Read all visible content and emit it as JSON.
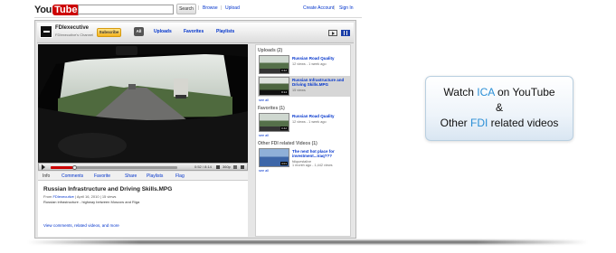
{
  "youtube": {
    "logo_you": "You",
    "logo_tube": "Tube",
    "search_button": "Search",
    "nav": [
      "Browse",
      "Upload"
    ],
    "account": [
      "Create Account",
      "Sign In"
    ]
  },
  "channel": {
    "name": "FDIexecutive",
    "subtitle": "FDIexecutive's Channel",
    "subscribe": "Subscribe",
    "all_button": "All",
    "tabs": [
      "Uploads",
      "Favorites",
      "Playlists"
    ]
  },
  "player": {
    "time": "0:52 / 8:14",
    "quality": "360p",
    "progress": 0.19
  },
  "video_tabs": [
    "Info",
    "Comments",
    "Favorite",
    "Share",
    "Playlists",
    "Flag"
  ],
  "video": {
    "title": "Russian Infrastructure and Driving Skills.MPG",
    "from_label": "From",
    "from_user": "FDIexecutive",
    "meta_rest": "| April 16, 2010 | 15 views",
    "description": "Russian infrastructure - highway between Moscow and Riga",
    "more_link": "View comments, related videos, and more"
  },
  "sidebar": {
    "uploads_header": "Uploads (2)",
    "uploads": [
      {
        "title": "Russian Road Quality",
        "meta": "12 views - 1 week ago",
        "duration": "0:42"
      },
      {
        "title": "Russian Infrastructure and Driving Skills.MPG",
        "meta": "15 views",
        "duration": "8:14"
      }
    ],
    "favorites_header": "Favorites (1)",
    "favorites": [
      {
        "title": "Russian Road Quality",
        "meta": "12 views - 1 week ago",
        "duration": "0:42"
      }
    ],
    "related_header": "Other FDI related Videos (1)",
    "related": [
      {
        "title": "The next hot place for investment...Iraq???",
        "meta1": "fdiquestalive",
        "meta2": "1 month ago - 1,442 views",
        "duration": "3:01"
      }
    ],
    "see_all": "see all"
  },
  "callout": {
    "line1_pre": "Watch ",
    "line1_hl": "ICA",
    "line1_post": " on YouTube",
    "amp": "&",
    "line3_pre": "Other ",
    "line3_hl": "FDI",
    "line3_post": " related videos"
  },
  "colors": {
    "accent_blue": "#2a8fd6",
    "youtube_red": "#cc0000",
    "link_blue": "#0033cc"
  }
}
